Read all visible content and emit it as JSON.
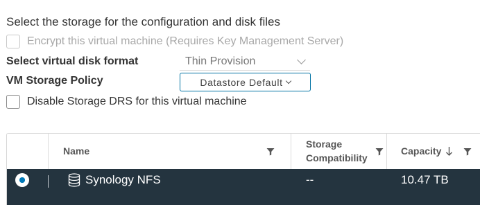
{
  "heading": "Select the storage for the configuration and disk files",
  "encrypt": {
    "label": "Encrypt this virtual machine (Requires Key Management Server)",
    "checked": false,
    "disabled": true
  },
  "disk_format": {
    "label": "Select virtual disk format",
    "value": "Thin Provision"
  },
  "storage_policy": {
    "label": "VM Storage Policy",
    "value": "Datastore Default"
  },
  "disable_drs": {
    "label": "Disable Storage DRS for this virtual machine",
    "checked": false
  },
  "grid": {
    "columns": [
      {
        "label": "Name",
        "filter": true
      },
      {
        "label_line1": "Storage",
        "label_line2": "Compatibility",
        "filter": true
      },
      {
        "label": "Capacity",
        "sort": "descending",
        "filter": true
      }
    ],
    "rows": [
      {
        "selected": true,
        "icon": "datastore-icon",
        "name": "Synology NFS",
        "compatibility": "--",
        "capacity": "10.47 TB"
      }
    ]
  },
  "colors": {
    "accent": "#0072a3",
    "selected_row_bg": "#24343f",
    "radio_selected": "#0079b8"
  }
}
